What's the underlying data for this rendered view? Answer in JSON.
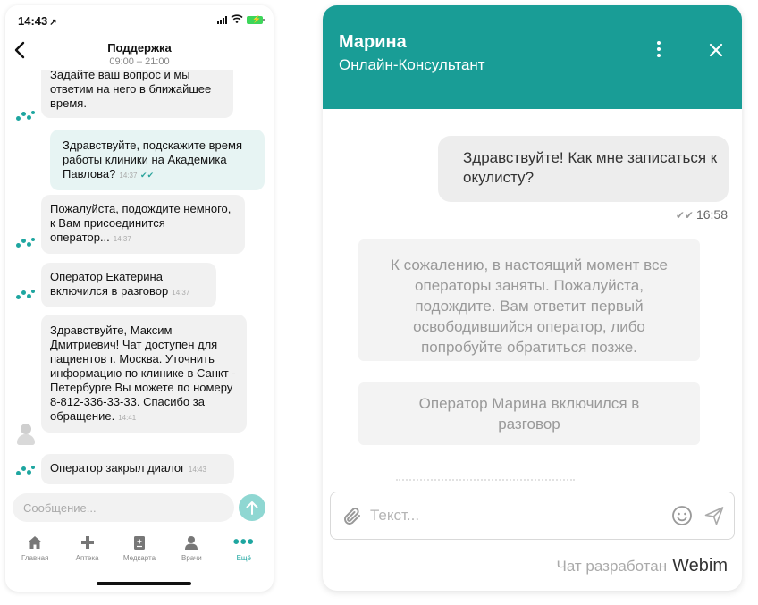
{
  "phone": {
    "status": {
      "time": "14:43",
      "arrow": "↗"
    },
    "header": {
      "back_icon": "chevron-left-icon",
      "title": "Поддержка",
      "hours": "09:00 – 21:00"
    },
    "messages": [
      {
        "dir": "in",
        "avatar": "bot",
        "text": "Задайте ваш вопрос и мы ответим на него в ближайшее время.",
        "time": ""
      },
      {
        "dir": "out",
        "text": "Здравствуйте, подскажите время работы клиники на Академика Павлова?",
        "time": "14:37"
      },
      {
        "dir": "in",
        "avatar": "bot",
        "text": "Пожалуйста, подождите немного, к Вам присоединится оператор...",
        "time": "14:37"
      },
      {
        "dir": "in",
        "avatar": "bot",
        "text": "Оператор Екатерина включился в разговор",
        "time": "14:37"
      },
      {
        "dir": "in",
        "avatar": "operator",
        "text": "Здравствуйте, Максим Дмитриевич! Чат доступен для пациентов г. Москва. Уточнить информацию по клинике в Санкт - Петербурге Вы можете по номеру 8-812-336-33-33. Спасибо за обращение.",
        "time": "14:41"
      },
      {
        "dir": "in",
        "avatar": "bot",
        "text": "Оператор закрыл диалог",
        "time": "14:43"
      }
    ],
    "composer": {
      "placeholder": "Сообщение...",
      "send_icon": "arrow-up-icon"
    },
    "tabs": [
      {
        "label": "Главная",
        "icon": "home-icon",
        "active": false
      },
      {
        "label": "Аптека",
        "icon": "plus-icon",
        "active": false
      },
      {
        "label": "Медкарта",
        "icon": "medcard-icon",
        "active": false
      },
      {
        "label": "Врачи",
        "icon": "doctor-icon",
        "active": false
      },
      {
        "label": "Ещё",
        "icon": "more-dots-icon",
        "active": true
      }
    ],
    "accent_color": "#1ea6a0"
  },
  "widget": {
    "header": {
      "name": "Марина",
      "role": "Онлайн-Консультант",
      "menu_icon": "kebab-menu-icon",
      "close_icon": "close-icon",
      "color": "#199d96"
    },
    "outgoing": {
      "text": "Здравствуйте! Как мне записаться к окулисту?",
      "time": "16:58"
    },
    "system_messages": [
      "К сожалению, в настоящий момент все операторы заняты. Пожалуйста, подождите. Вам ответит первый освободившийся оператор, либо попробуйте обратиться позже.",
      "Оператор Марина включился в разговор"
    ],
    "composer": {
      "placeholder": "Текст...",
      "attach_icon": "paperclip-icon",
      "emoji_icon": "smiley-icon",
      "send_icon": "send-icon"
    },
    "footer": {
      "text": "Чат разработан",
      "brand": "Webim"
    }
  }
}
